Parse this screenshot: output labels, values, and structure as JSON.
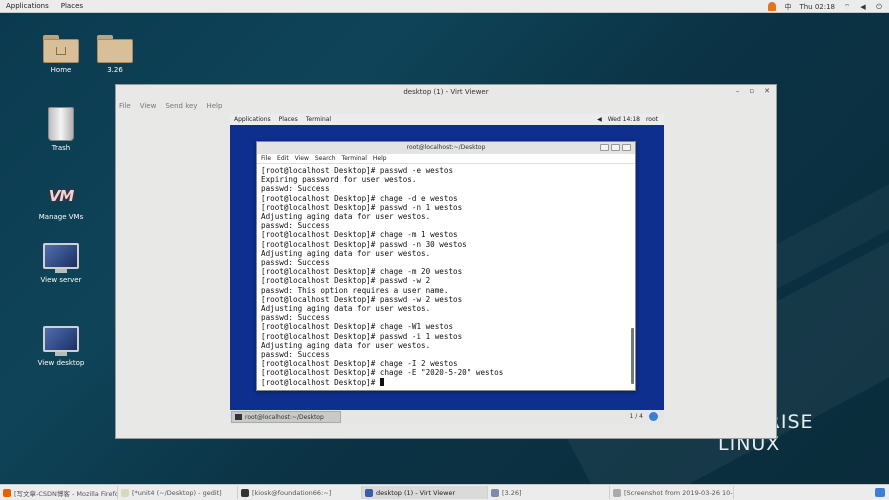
{
  "topbar": {
    "applications": "Applications",
    "places": "Places",
    "lang": "中",
    "clock": "Thu 02:18"
  },
  "desktop": {
    "icons": [
      {
        "label": "Home"
      },
      {
        "label": "3.26"
      },
      {
        "label": "Trash"
      },
      {
        "label": "Manage VMs"
      },
      {
        "label": "View server"
      },
      {
        "label": "View desktop"
      }
    ],
    "brand_line1": "RPRISE",
    "brand_line2": "LINUX"
  },
  "virt_viewer": {
    "title": "desktop (1) - Virt Viewer",
    "menu": [
      "File",
      "View",
      "Send key",
      "Help"
    ],
    "guest": {
      "topbar": {
        "applications": "Applications",
        "places": "Places",
        "terminal": "Terminal",
        "clock": "Wed 14:18",
        "user": "root"
      },
      "taskbar": {
        "task": "root@localhost:~/Desktop",
        "pager": "1 / 4"
      }
    }
  },
  "terminal": {
    "title": "root@localhost:~/Desktop",
    "menu": [
      "File",
      "Edit",
      "View",
      "Search",
      "Terminal",
      "Help"
    ],
    "lines": [
      "[root@localhost Desktop]# passwd -e westos",
      "Expiring password for user westos.",
      "passwd: Success",
      "[root@localhost Desktop]# chage -d e westos",
      "[root@localhost Desktop]# passwd -n 1 westos",
      "Adjusting aging data for user westos.",
      "passwd: Success",
      "[root@localhost Desktop]# chage -m 1 westos",
      "[root@localhost Desktop]# passwd -n 30 westos",
      "Adjusting aging data for user westos.",
      "passwd: Success",
      "[root@localhost Desktop]# chage -m 20 westos",
      "[root@localhost Desktop]# passwd -w 2",
      "passwd: This option requires a user name.",
      "[root@localhost Desktop]# passwd -w 2 westos",
      "Adjusting aging data for user westos.",
      "passwd: Success",
      "[root@localhost Desktop]# chage -W1 westos",
      "[root@localhost Desktop]# passwd -i 1 westos",
      "Adjusting aging data for user westos.",
      "passwd: Success",
      "[root@localhost Desktop]# chage -I 2 westos",
      "[root@localhost Desktop]# chage -E \"2020-5-20\" westos"
    ],
    "prompt": "[root@localhost Desktop]# "
  },
  "taskbar": {
    "tasks": [
      "[写文章-CSDN博客 - Mozilla Firefox]",
      "[*unit4 (~/Desktop) - gedit]",
      "[kiosk@foundation66:~]",
      "desktop (1) - Virt Viewer",
      "[3.26]",
      "[Screenshot from 2019-03-26 10-..."
    ]
  }
}
